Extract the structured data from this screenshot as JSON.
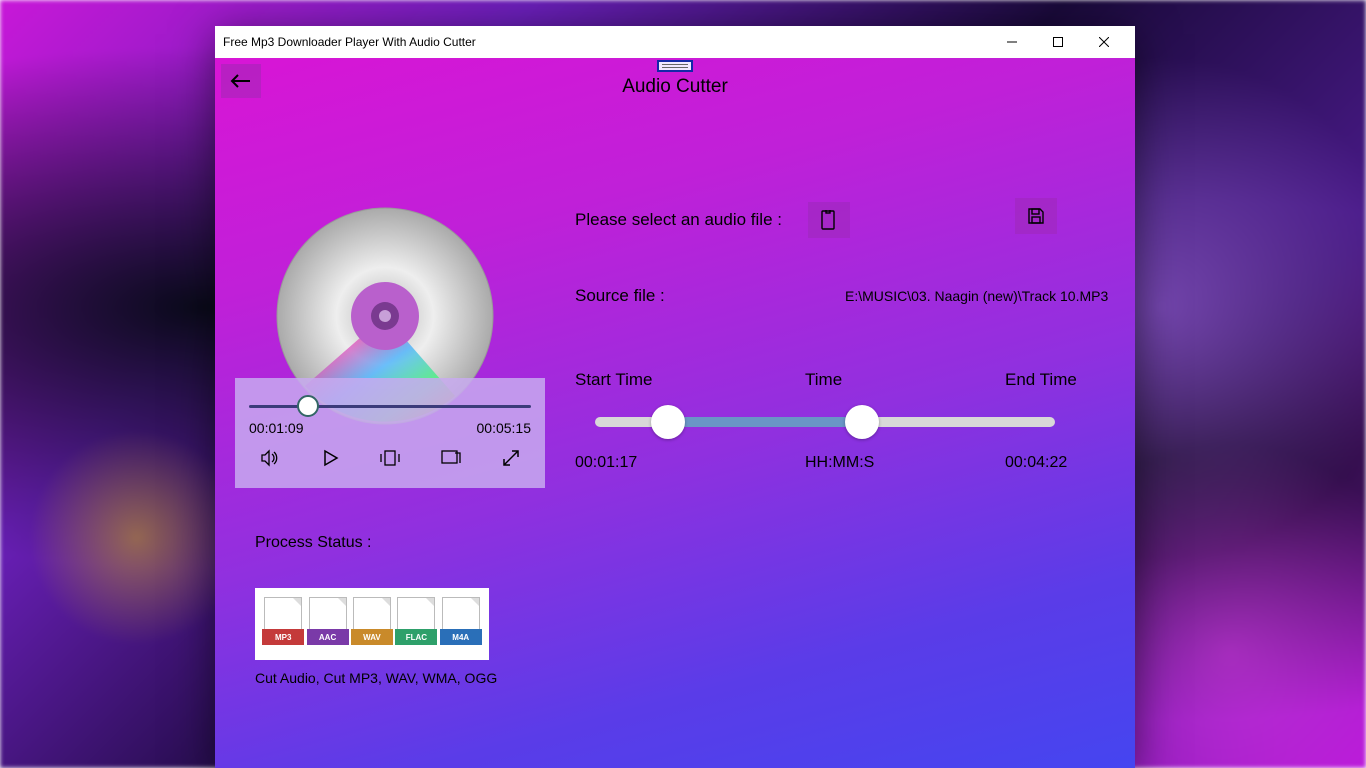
{
  "window": {
    "title": "Free Mp3 Downloader Player With Audio Cutter"
  },
  "header": {
    "page_title": "Audio Cutter"
  },
  "select": {
    "label": "Please select an audio file :"
  },
  "source": {
    "label": "Source file :",
    "path": "E:\\MUSIC\\03. Naagin (new)\\Track 10.MP3"
  },
  "range": {
    "start_label": "Start Time",
    "time_label": "Time",
    "end_label": "End Time",
    "start_value": "00:01:17",
    "time_value": "HH:MM:S",
    "end_value": "00:04:22"
  },
  "player": {
    "current": "00:01:09",
    "duration": "00:05:15"
  },
  "process": {
    "label": "Process Status :"
  },
  "formats": {
    "items": [
      "MP3",
      "AAC",
      "WAV",
      "FLAC",
      "M4A"
    ],
    "colors": [
      "#c43a3a",
      "#7a3aa8",
      "#c98a2a",
      "#2ea06a",
      "#2a6fb8"
    ],
    "caption": "Cut Audio, Cut MP3, WAV, WMA, OGG"
  }
}
